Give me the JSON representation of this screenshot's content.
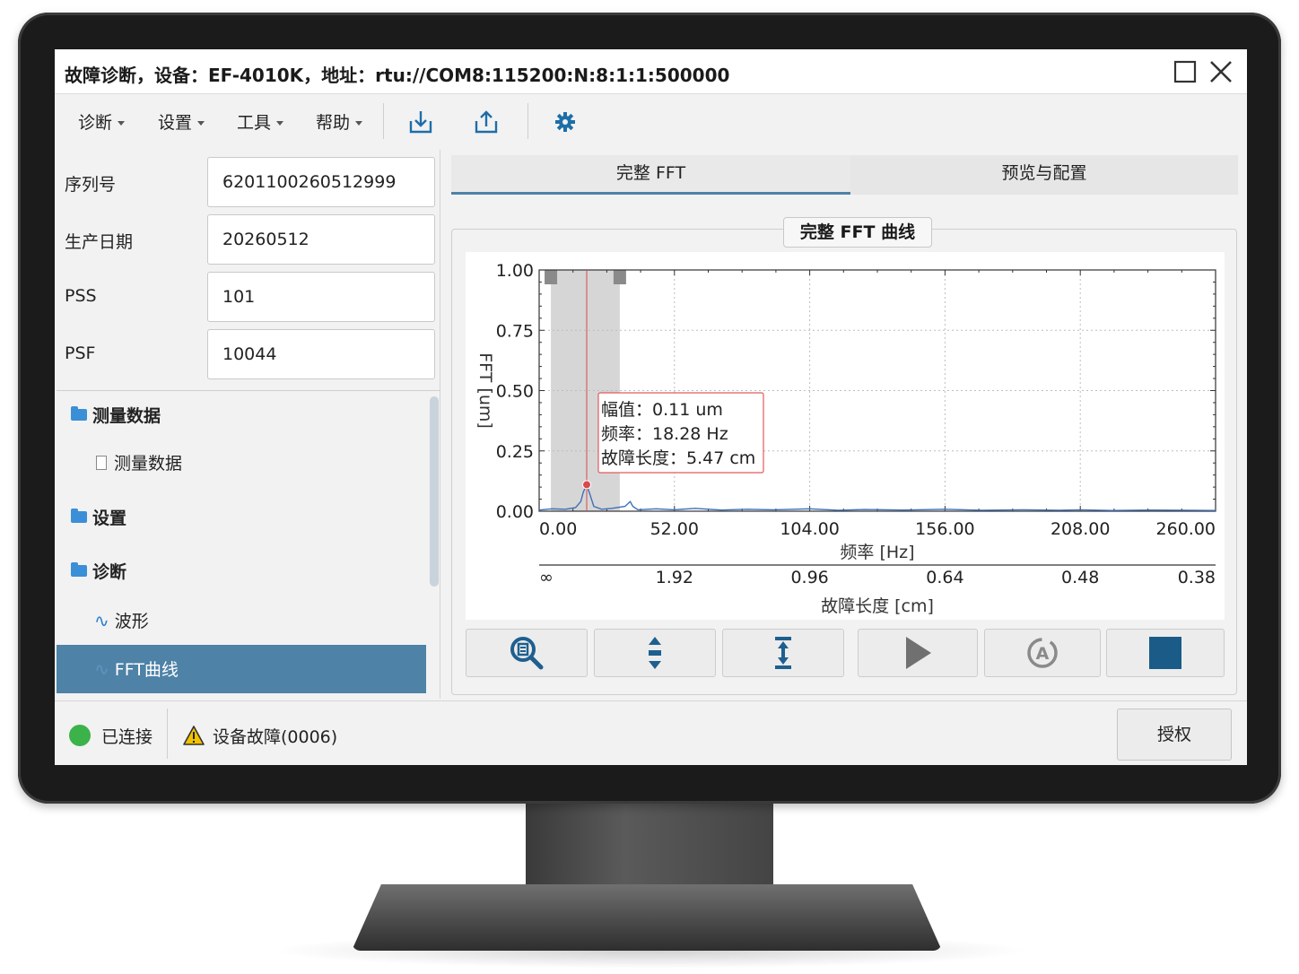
{
  "window": {
    "title": "故障诊断，设备：EF-4010K，地址：rtu://COM8:115200:N:8:1:1:500000"
  },
  "menu": {
    "items": [
      {
        "label": "诊断"
      },
      {
        "label": "设置"
      },
      {
        "label": "工具"
      },
      {
        "label": "帮助"
      }
    ],
    "toolbar_icons": [
      "import-icon",
      "export-icon",
      "gear-icon"
    ]
  },
  "properties": [
    {
      "label": "序列号",
      "value": "6201100260512999"
    },
    {
      "label": "生产日期",
      "value": "20260512"
    },
    {
      "label": "PSS",
      "value": "101"
    },
    {
      "label": "PSF",
      "value": "10044"
    }
  ],
  "tree": [
    {
      "label": "测量数据",
      "kind": "folder"
    },
    {
      "label": "测量数据",
      "kind": "file"
    },
    {
      "label": "设置",
      "kind": "folder"
    },
    {
      "label": "诊断",
      "kind": "folder"
    },
    {
      "label": "波形",
      "kind": "wave"
    },
    {
      "label": "FFT曲线",
      "kind": "wave",
      "selected": true
    }
  ],
  "tabs": [
    {
      "label": "完整 FFT",
      "active": true
    },
    {
      "label": "预览与配置",
      "active": false
    }
  ],
  "group_title": "完整 FFT 曲线",
  "chart_data": {
    "type": "line",
    "ylabel": "FFT [um]",
    "xlabel": "频率 [Hz]",
    "x2label": "故障长度 [cm]",
    "xlim": [
      0,
      260
    ],
    "ylim": [
      0,
      1
    ],
    "x_ticks": [
      "0.00",
      "52.00",
      "104.00",
      "156.00",
      "208.00",
      "260.00"
    ],
    "y_ticks": [
      "0.00",
      "0.25",
      "0.50",
      "0.75",
      "1.00"
    ],
    "x2_ticks": [
      "∞",
      "1.92",
      "0.96",
      "0.64",
      "0.48",
      "0.38"
    ],
    "grid": true,
    "series_color": "#3f6fb8",
    "highlight_range": [
      4.5,
      31
    ],
    "marker": {
      "x": 18.28,
      "y": 0.11
    },
    "series": [
      {
        "values": [
          [
            0,
            0.005
          ],
          [
            5,
            0.01
          ],
          [
            10,
            0.008
          ],
          [
            14,
            0.015
          ],
          [
            16,
            0.04
          ],
          [
            17,
            0.08
          ],
          [
            18.28,
            0.11
          ],
          [
            19.5,
            0.07
          ],
          [
            21,
            0.02
          ],
          [
            24,
            0.008
          ],
          [
            28,
            0.012
          ],
          [
            33,
            0.02
          ],
          [
            35,
            0.04
          ],
          [
            36,
            0.02
          ],
          [
            38,
            0.006
          ],
          [
            45,
            0.01
          ],
          [
            52,
            0.006
          ],
          [
            60,
            0.012
          ],
          [
            70,
            0.005
          ],
          [
            80,
            0.008
          ],
          [
            90,
            0.006
          ],
          [
            104,
            0.01
          ],
          [
            115,
            0.004
          ],
          [
            125,
            0.007
          ],
          [
            140,
            0.005
          ],
          [
            156,
            0.008
          ],
          [
            170,
            0.004
          ],
          [
            185,
            0.006
          ],
          [
            200,
            0.004
          ],
          [
            208,
            0.006
          ],
          [
            220,
            0.003
          ],
          [
            235,
            0.005
          ],
          [
            248,
            0.004
          ],
          [
            260,
            0.003
          ]
        ]
      }
    ],
    "tooltip": {
      "amplitude": "幅值：0.11 um",
      "frequency": "频率：18.28 Hz",
      "fault_length": "故障长度：5.47 cm"
    }
  },
  "plot_tools": [
    "zoom-icon",
    "vertical-pan-icon",
    "vertical-range-icon",
    "play-icon",
    "auto-scale-icon",
    "stop-icon"
  ],
  "status": {
    "connection": "已连接",
    "connection_color": "#3bb24a",
    "warning": "设备故障(0006)",
    "auth_button": "授权"
  }
}
